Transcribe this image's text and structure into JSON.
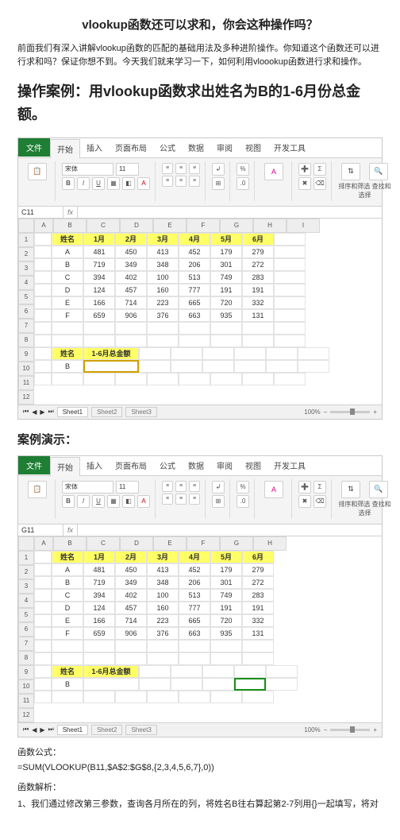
{
  "title": "vlookup函数还可以求和，你会这种操作吗？",
  "intro": "前面我们有深入讲解vlookup函数的匹配的基础用法及多种进阶操作。你知道这个函数还可以进行求和吗？保证你想不到。今天我们就来学习一下，如何利用vloookup函数进行求和操作。",
  "h2": "操作案例：用vlookup函数求出姓名为B的1-6月份总金额。",
  "h3_demo": "案例演示：",
  "ribbon": {
    "file": "文件",
    "tabs": [
      "开始",
      "插入",
      "页面布局",
      "公式",
      "数据",
      "审阅",
      "视图",
      "开发工具"
    ],
    "font_name": "宋体",
    "font_size": "11",
    "sort_label": "排序和筛选 查找和选择"
  },
  "sheet_tabs": [
    "Sheet1",
    "Sheet2",
    "Sheet3"
  ],
  "zoom": "100%",
  "screenshot1": {
    "namebox": "C11",
    "fbar": "",
    "cols": [
      "A",
      "B",
      "C",
      "D",
      "E",
      "F",
      "G",
      "H",
      "I"
    ],
    "rows": [
      "1",
      "2",
      "3",
      "4",
      "5",
      "6",
      "7",
      "8",
      "9",
      "10",
      "11",
      "12"
    ],
    "header": [
      "姓名",
      "1月",
      "2月",
      "3月",
      "4月",
      "5月",
      "6月"
    ],
    "data": [
      [
        "A",
        "481",
        "450",
        "413",
        "452",
        "179",
        "279"
      ],
      [
        "B",
        "719",
        "349",
        "348",
        "206",
        "301",
        "272"
      ],
      [
        "C",
        "394",
        "402",
        "100",
        "513",
        "749",
        "283"
      ],
      [
        "D",
        "124",
        "457",
        "160",
        "777",
        "191",
        "191"
      ],
      [
        "E",
        "166",
        "714",
        "223",
        "665",
        "720",
        "332"
      ],
      [
        "F",
        "659",
        "906",
        "376",
        "663",
        "935",
        "131"
      ]
    ],
    "sub_header": [
      "姓名",
      "1-6月总金额"
    ],
    "sub_row": [
      "B",
      ""
    ]
  },
  "screenshot2": {
    "namebox": "G11",
    "fbar": "",
    "cols": [
      "A",
      "B",
      "C",
      "D",
      "E",
      "F",
      "G",
      "H"
    ],
    "rows": [
      "1",
      "2",
      "3",
      "4",
      "5",
      "6",
      "7",
      "8",
      "9",
      "10",
      "11",
      "12"
    ],
    "header": [
      "姓名",
      "1月",
      "2月",
      "3月",
      "4月",
      "5月",
      "6月"
    ],
    "data": [
      [
        "A",
        "481",
        "450",
        "413",
        "452",
        "179",
        "279"
      ],
      [
        "B",
        "719",
        "349",
        "348",
        "206",
        "301",
        "272"
      ],
      [
        "C",
        "394",
        "402",
        "100",
        "513",
        "749",
        "283"
      ],
      [
        "D",
        "124",
        "457",
        "160",
        "777",
        "191",
        "191"
      ],
      [
        "E",
        "166",
        "714",
        "223",
        "665",
        "720",
        "332"
      ],
      [
        "F",
        "659",
        "906",
        "376",
        "663",
        "935",
        "131"
      ]
    ],
    "sub_header": [
      "姓名",
      "1-6月总金额"
    ],
    "sub_row": [
      "B",
      ""
    ]
  },
  "formula_label": "函数公式：",
  "formula": "=SUM(VLOOKUP(B11,$A$2:$G$8,{2,3,4,5,6,7},0))",
  "explain_label": "函数解析：",
  "explain1": "1、我们通过修改第三参数，查询各月所在的列，将姓名B往右算起第2-7列用{}一起填写，将对"
}
